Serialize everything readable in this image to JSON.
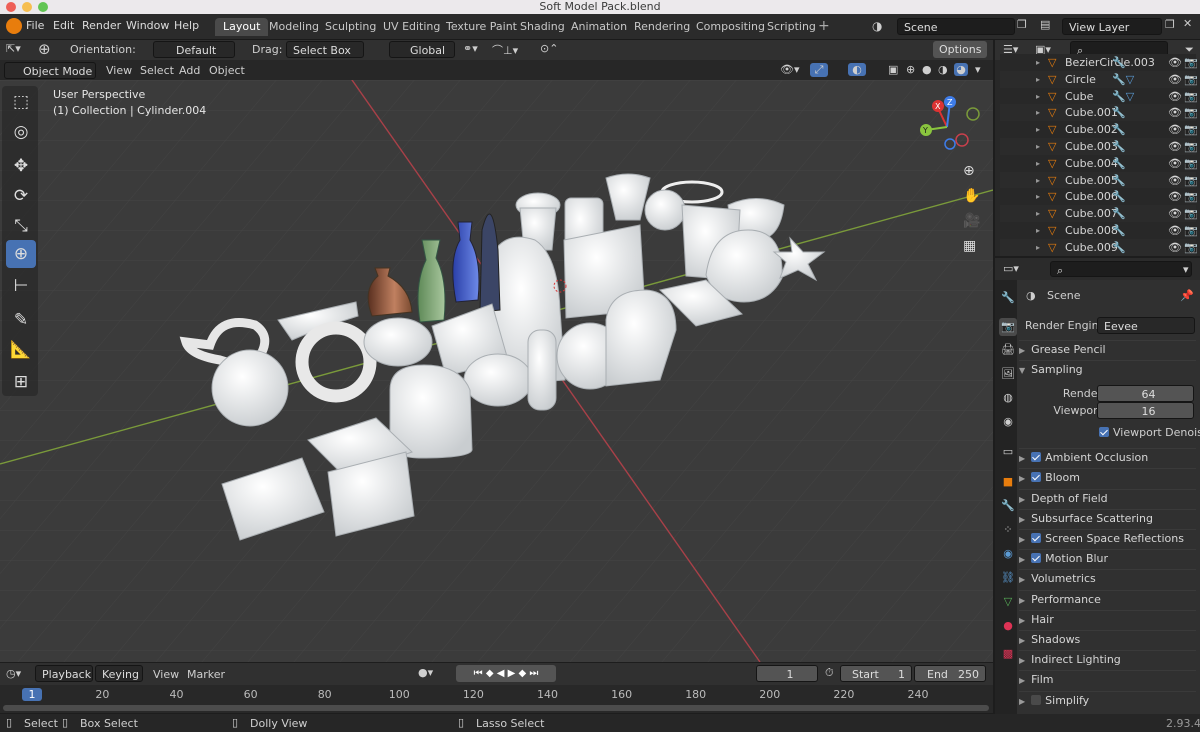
{
  "window": {
    "title": "Soft Model Pack.blend"
  },
  "menubar": {
    "items": [
      "File",
      "Edit",
      "Render",
      "Window",
      "Help"
    ]
  },
  "workspaces": {
    "tabs": [
      "Layout",
      "Modeling",
      "Sculpting",
      "UV Editing",
      "Texture Paint",
      "Shading",
      "Animation",
      "Rendering",
      "Compositing",
      "Scripting"
    ],
    "active": "Layout"
  },
  "scene": {
    "name": "Scene",
    "view_layer": "View Layer"
  },
  "tool_header": {
    "orientation_label": "Orientation:",
    "orientation_value": "Default",
    "drag_label": "Drag:",
    "drag_value": "Select Box",
    "transform_orientation": "Global",
    "options": "Options"
  },
  "viewport_header": {
    "mode": "Object Mode",
    "menus": [
      "View",
      "Select",
      "Add",
      "Object"
    ]
  },
  "viewport": {
    "perspective": "User Perspective",
    "collection": "(1) Collection | Cylinder.004",
    "gizmo": {
      "x": "X",
      "y": "Y",
      "z": "Z"
    }
  },
  "outliner": {
    "search_placeholder": "",
    "items": [
      "BezierCircle.003",
      "Circle",
      "Cube",
      "Cube.001",
      "Cube.002",
      "Cube.003",
      "Cube.004",
      "Cube.005",
      "Cube.006",
      "Cube.007",
      "Cube.008",
      "Cube.009"
    ]
  },
  "properties": {
    "context": "Scene",
    "render_engine_label": "Render Engine",
    "render_engine": "Eevee",
    "panels": [
      {
        "label": "Grease Pencil",
        "checkbox": null
      },
      {
        "label": "Sampling",
        "checkbox": null,
        "expanded": true
      },
      {
        "label": "Ambient Occlusion",
        "checkbox": true
      },
      {
        "label": "Bloom",
        "checkbox": true
      },
      {
        "label": "Depth of Field",
        "checkbox": null
      },
      {
        "label": "Subsurface Scattering",
        "checkbox": null
      },
      {
        "label": "Screen Space Reflections",
        "checkbox": true
      },
      {
        "label": "Motion Blur",
        "checkbox": true
      },
      {
        "label": "Volumetrics",
        "checkbox": null
      },
      {
        "label": "Performance",
        "checkbox": null
      },
      {
        "label": "Hair",
        "checkbox": null
      },
      {
        "label": "Shadows",
        "checkbox": null
      },
      {
        "label": "Indirect Lighting",
        "checkbox": null
      },
      {
        "label": "Film",
        "checkbox": null
      },
      {
        "label": "Simplify",
        "checkbox": false
      }
    ],
    "sampling": {
      "render_label": "Render",
      "render": "64",
      "viewport_label": "Viewport",
      "viewport": "16",
      "denoise": "Viewport Denois..."
    }
  },
  "timeline": {
    "menus": [
      "Playback",
      "Keying",
      "View",
      "Marker"
    ],
    "current_frame": "1",
    "start_label": "Start",
    "start": "1",
    "end_label": "End",
    "end": "250",
    "ruler": [
      "1",
      "20",
      "40",
      "60",
      "80",
      "100",
      "120",
      "140",
      "160",
      "180",
      "200",
      "220",
      "240"
    ]
  },
  "statusbar": {
    "select": "Select",
    "box_select": "Box Select",
    "dolly": "Dolly View",
    "lasso": "Lasso Select",
    "version": "2.93.4"
  },
  "colors": {
    "accent": "#4772b3",
    "x_axis": "#c8404c",
    "y_axis": "#8ac53e",
    "z_axis": "#3e7ce8"
  }
}
